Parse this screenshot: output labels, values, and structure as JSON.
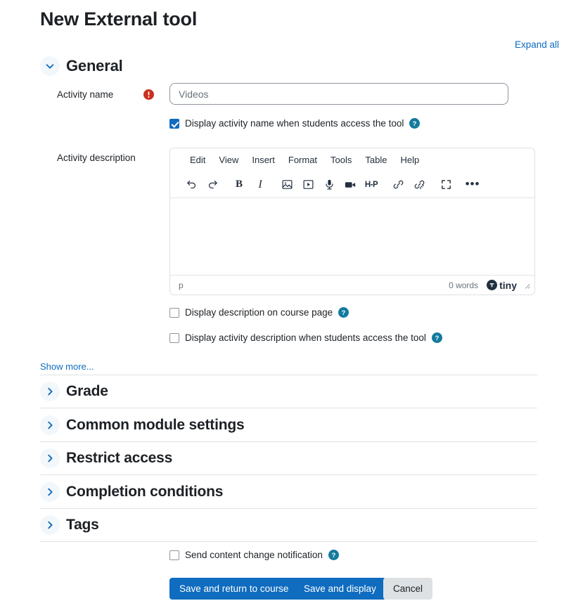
{
  "page": {
    "title": "New External tool",
    "expand_all_label": "Expand all",
    "show_more_label": "Show more..."
  },
  "colors": {
    "primary_blue": "#0f6cbf",
    "link_blue": "#0f6cbf",
    "help_teal": "#127b9e",
    "required_red": "#ca3120",
    "border_gray": "#8f959e",
    "rule_gray": "#dee2e6",
    "secondary_button": "#dee1e3"
  },
  "sections": [
    {
      "id": "general",
      "label": "General",
      "expanded": true,
      "icon": "chevron-down-icon"
    },
    {
      "id": "grade",
      "label": "Grade",
      "expanded": false,
      "icon": "chevron-right-icon"
    },
    {
      "id": "common-module-settings",
      "label": "Common module settings",
      "expanded": false,
      "icon": "chevron-right-icon"
    },
    {
      "id": "restrict-access",
      "label": "Restrict access",
      "expanded": false,
      "icon": "chevron-right-icon"
    },
    {
      "id": "completion-conditions",
      "label": "Completion conditions",
      "expanded": false,
      "icon": "chevron-right-icon"
    },
    {
      "id": "tags",
      "label": "Tags",
      "expanded": false,
      "icon": "chevron-right-icon"
    }
  ],
  "general": {
    "activity_name": {
      "label": "Activity name",
      "value": "",
      "placeholder": "Videos",
      "required": true,
      "required_icon": "required-error-icon"
    },
    "display_name_checkbox": {
      "label": "Display activity name when students access the tool",
      "checked": true,
      "help_icon": "help-icon"
    },
    "activity_description": {
      "label": "Activity description"
    },
    "display_description_course_page": {
      "label": "Display description on course page",
      "checked": false,
      "help_icon": "help-icon"
    },
    "display_description_access_tool": {
      "label": "Display activity description when students access the tool",
      "checked": false,
      "help_icon": "help-icon"
    }
  },
  "editor": {
    "menubar": [
      "Edit",
      "View",
      "Insert",
      "Format",
      "Tools",
      "Table",
      "Help"
    ],
    "toolbar": [
      {
        "name": "undo-icon",
        "label": "Undo"
      },
      {
        "name": "redo-icon",
        "label": "Redo"
      },
      {
        "name": "bold-icon",
        "label": "B"
      },
      {
        "name": "italic-icon",
        "label": "I"
      },
      {
        "name": "image-icon",
        "label": "Image"
      },
      {
        "name": "media-play-icon",
        "label": "Media"
      },
      {
        "name": "microphone-icon",
        "label": "Record audio"
      },
      {
        "name": "video-camera-icon",
        "label": "Record video"
      },
      {
        "name": "h5p-icon",
        "label": "H-P"
      },
      {
        "name": "link-icon",
        "label": "Link"
      },
      {
        "name": "unlink-icon",
        "label": "Unlink"
      },
      {
        "name": "fullscreen-icon",
        "label": "Fullscreen"
      },
      {
        "name": "more-options-icon",
        "label": "More"
      }
    ],
    "content": "",
    "statusbar": {
      "element_path": "p",
      "word_count": "0 words",
      "brand": "tiny",
      "brand_icon": "tiny-logo-icon",
      "resize_handle_icon": "resize-handle-icon"
    }
  },
  "footer": {
    "send_notification_checkbox": {
      "label": "Send content change notification",
      "checked": false,
      "help_icon": "help-icon"
    },
    "buttons": [
      {
        "name": "save-and-return-to-course-button",
        "label": "Save and return to course",
        "style": "primary"
      },
      {
        "name": "save-and-display-button",
        "label": "Save and display",
        "style": "primary"
      },
      {
        "name": "cancel-button",
        "label": "Cancel",
        "style": "secondary"
      }
    ]
  }
}
